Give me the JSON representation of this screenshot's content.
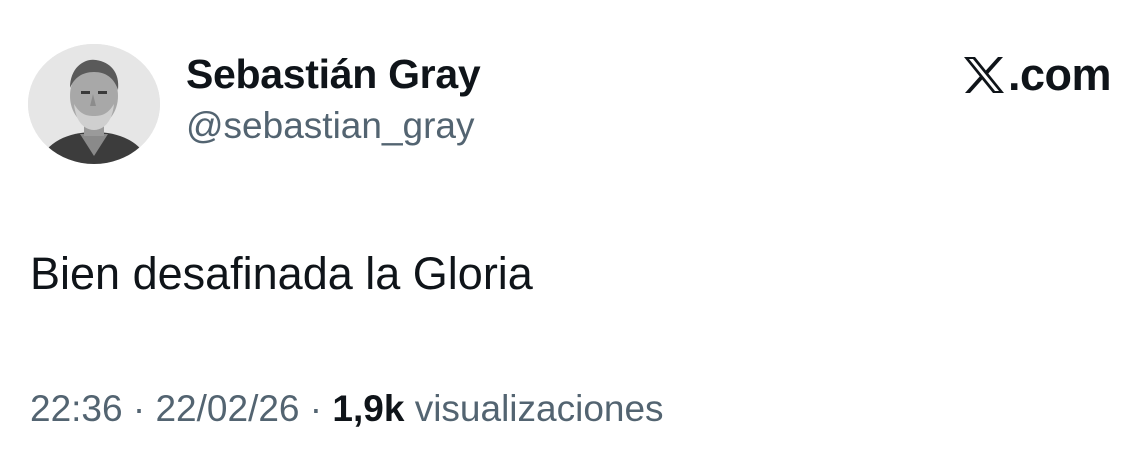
{
  "author": {
    "display_name": "Sebastián Gray",
    "handle": "@sebastian_gray"
  },
  "brand": {
    "logo_icon": "x-logo-icon",
    "suffix": ".com"
  },
  "tweet": {
    "text": "Bien desafinada la Gloria"
  },
  "meta": {
    "time": "22:36",
    "separator": "·",
    "date": "22/02/26",
    "views_count": "1,9k",
    "views_label": "visualizaciones"
  },
  "colors": {
    "text_primary": "#0f1419",
    "text_secondary": "#536471",
    "background": "#ffffff"
  }
}
